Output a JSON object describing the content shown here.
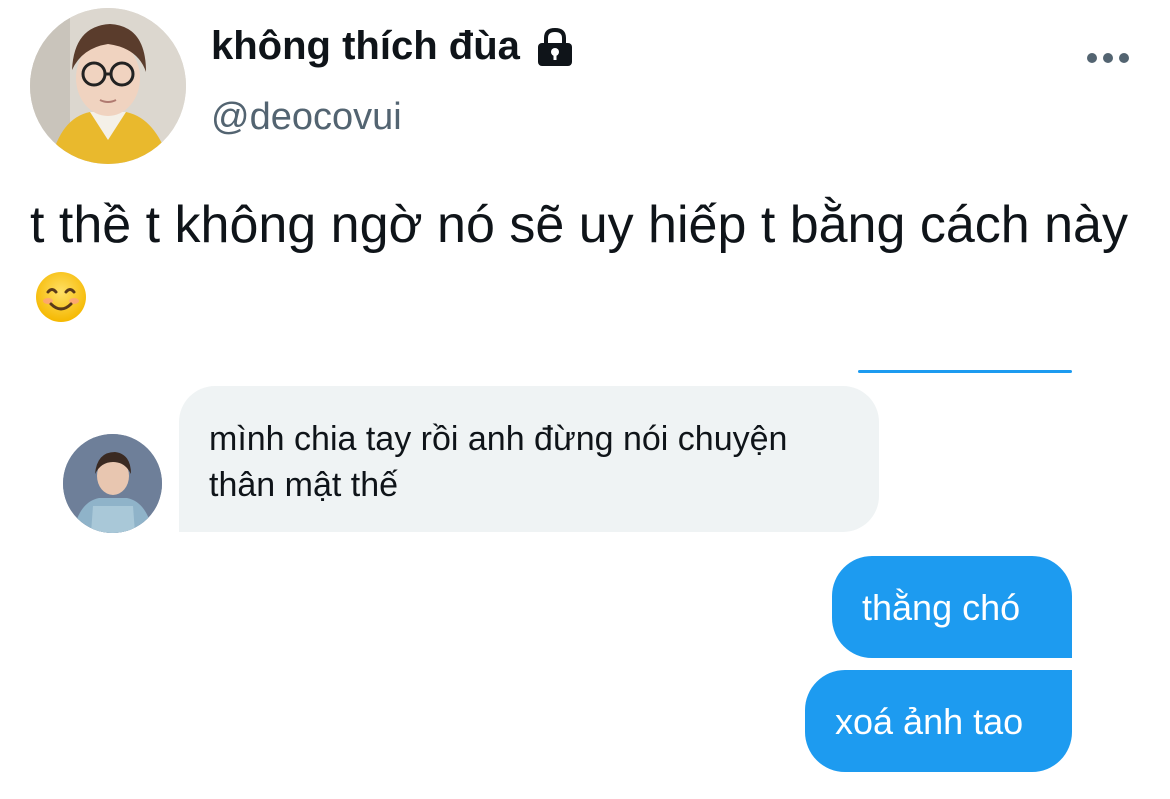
{
  "profile": {
    "display_name": "không thích đùa",
    "handle": "@deocovui",
    "avatar_icon": "profile-photo",
    "protected_icon": "lock-icon"
  },
  "menu": {
    "more_icon": "more-horizontal-icon"
  },
  "tweet": {
    "text": "t thề t không ngờ nó sẽ uy hiếp t bằng cách này",
    "emoji": "smiling-face-emoji"
  },
  "dm_screenshot": {
    "received_message": "mình chia tay rồi anh đừng nói chuyện thân mật thế",
    "sent_messages": [
      "thằng chó",
      "xoá ảnh tao"
    ]
  },
  "colors": {
    "accent": "#1d9bf0",
    "bubble_gray": "#eff3f4",
    "text_primary": "#0f1419",
    "text_secondary": "#536471"
  }
}
